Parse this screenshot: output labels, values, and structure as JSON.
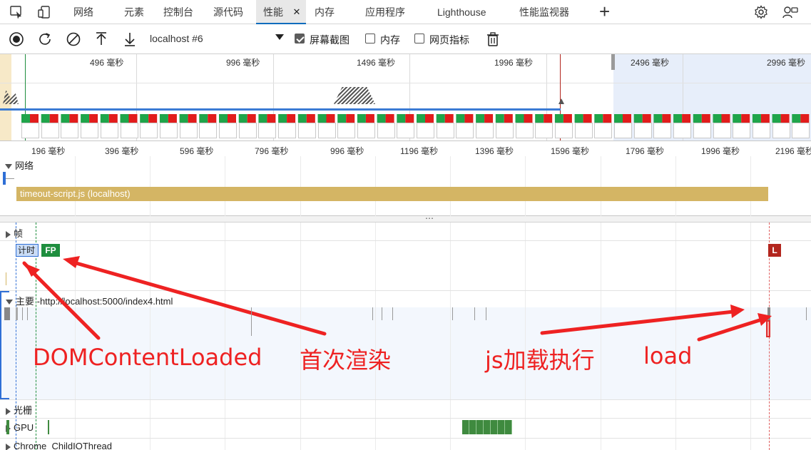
{
  "tabs": [
    {
      "label": "网络"
    },
    {
      "label": "元素"
    },
    {
      "label": "控制台"
    },
    {
      "label": "源代码"
    },
    {
      "label": "性能",
      "active": true
    },
    {
      "label": "内存"
    },
    {
      "label": "应用程序"
    },
    {
      "label": "Lighthouse"
    },
    {
      "label": "性能监视器"
    }
  ],
  "toolbar": {
    "profile": "localhost #6",
    "screenshots_label": "屏幕截图",
    "screenshots_checked": true,
    "memory_label": "内存",
    "memory_checked": false,
    "webvitals_label": "网页指标",
    "webvitals_checked": false
  },
  "overview": {
    "ticks": [
      "496 毫秒",
      "996 毫秒",
      "1496 毫秒",
      "1996 毫秒",
      "2496 毫秒",
      "2996 毫秒"
    ]
  },
  "ruler": {
    "ticks": [
      "196 毫秒",
      "396 毫秒",
      "596 毫秒",
      "796 毫秒",
      "996 毫秒",
      "1196 毫秒",
      "1396 毫秒",
      "1596 毫秒",
      "1796 毫秒",
      "1996 毫秒",
      "2196 毫秒"
    ]
  },
  "network": {
    "title": "网络",
    "request_label": "timeout-script.js (localhost)"
  },
  "tracks": {
    "frames": "帧",
    "timings": "计时",
    "fp": "FP",
    "load_marker": "L",
    "main": "主要 -http://localhost:5000/index4.html",
    "raster": "光栅",
    "gpu": "GPU",
    "childio": "Chrome_ChildIOThread"
  },
  "annotations": {
    "dom": "DOMContentLoaded",
    "first_paint": "首次渲染",
    "js": "js加载执行",
    "load": "load"
  },
  "colors": {
    "accent": "#0f6cbd",
    "network_bar": "#d4b564",
    "fp": "#1e8e3e",
    "load": "#b3261e",
    "annotation": "#ee2222"
  }
}
